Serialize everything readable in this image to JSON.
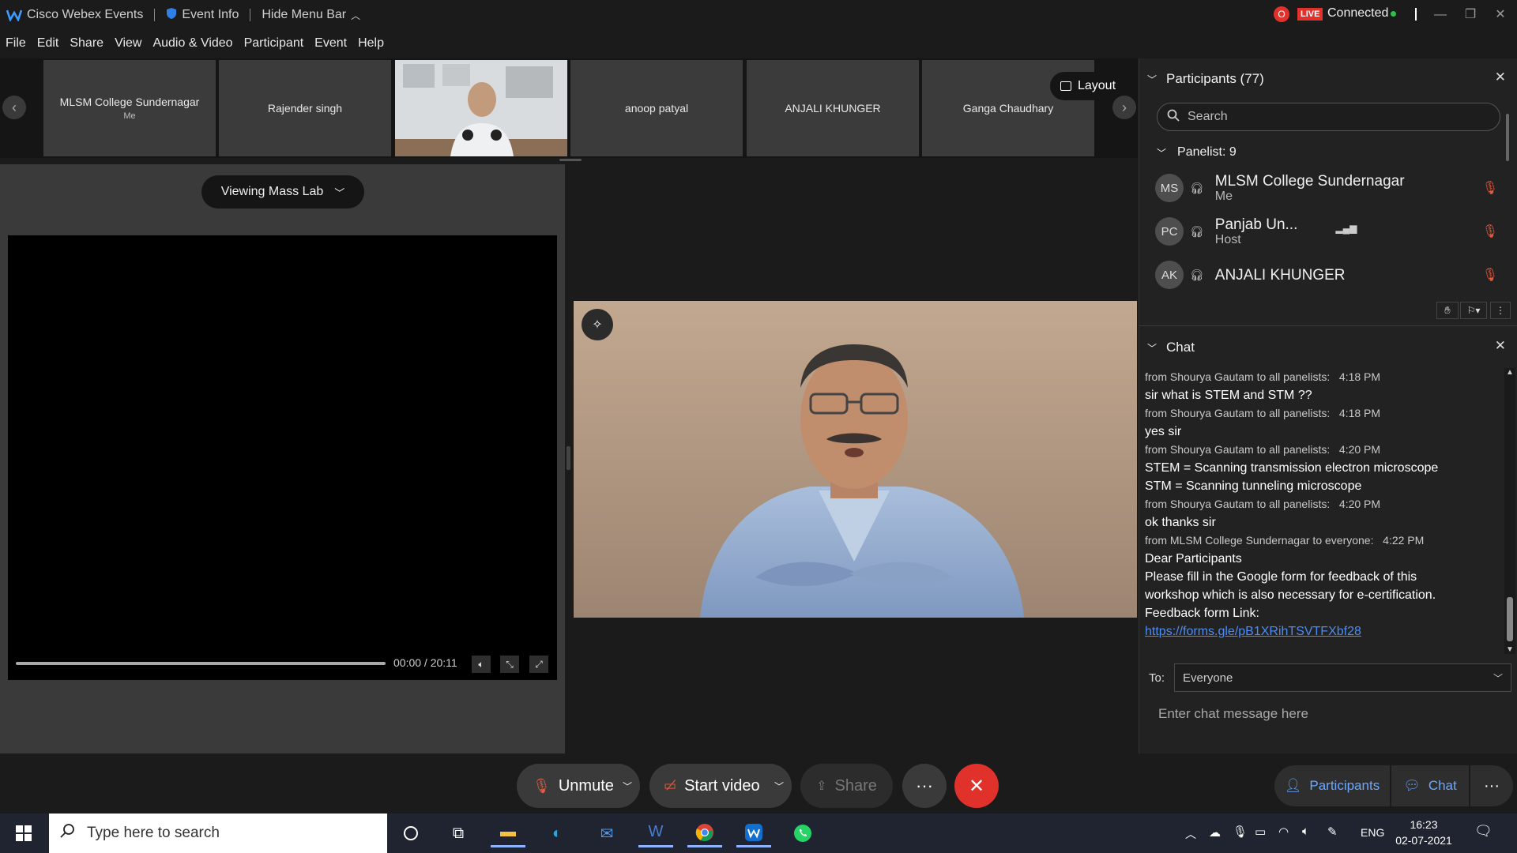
{
  "titlebar": {
    "app_name": "Cisco Webex Events",
    "event_info": "Event Info",
    "hide_menu": "Hide Menu Bar",
    "live_badge": "LIVE",
    "record_label": "O",
    "connected": "Connected"
  },
  "menu": [
    "File",
    "Edit",
    "Share",
    "View",
    "Audio & Video",
    "Participant",
    "Event",
    "Help"
  ],
  "strip": {
    "thumbs": [
      {
        "name": "MLSM College Sundernagar",
        "sub": "Me"
      },
      {
        "name": "Rajender singh",
        "sub": ""
      },
      {
        "name": "",
        "sub": ""
      },
      {
        "name": "anoop patyal",
        "sub": ""
      },
      {
        "name": "ANJALI KHUNGER",
        "sub": ""
      },
      {
        "name": "Ganga Chaudhary",
        "sub": ""
      }
    ],
    "layout_label": "Layout"
  },
  "player": {
    "viewing_label": "Viewing Mass Lab",
    "time": "00:00 / 20:11",
    "progress": 0
  },
  "participants": {
    "header": "Participants (77)",
    "search_placeholder": "Search",
    "panelist_group": "Panelist: 9",
    "list": [
      {
        "initials": "MS",
        "name": "MLSM College Sundernagar",
        "role": "Me"
      },
      {
        "initials": "PC",
        "name": "Panjab Un...",
        "role": "Host"
      },
      {
        "initials": "AK",
        "name": "ANJALI KHUNGER",
        "role": ""
      }
    ]
  },
  "chat": {
    "header": "Chat",
    "messages": [
      {
        "meta_from": "from Shourya Gautam to all panelists:",
        "time": "4:18 PM",
        "lines": [
          "sir what is STEM and STM ??"
        ]
      },
      {
        "meta_from": "from Shourya Gautam to all panelists:",
        "time": "4:18 PM",
        "lines": [
          "yes sir"
        ]
      },
      {
        "meta_from": "from Shourya Gautam to all panelists:",
        "time": "4:20 PM",
        "lines": [
          "STEM = Scanning transmission electron microscope",
          "STM = Scanning tunneling microscope"
        ]
      },
      {
        "meta_from": "from Shourya Gautam to all panelists:",
        "time": "4:20 PM",
        "lines": [
          "ok thanks sir"
        ]
      },
      {
        "meta_from": "from MLSM College Sundernagar to everyone:",
        "time": "4:22 PM",
        "lines": [
          "Dear Participants",
          "Please fill in the Google form for feedback of this",
          "workshop which is also necessary for e-certification.",
          "Feedback form Link:"
        ]
      }
    ],
    "link": "https://forms.gle/pB1XRihTSVTFXbf28",
    "to_label": "To:",
    "to_value": "Everyone",
    "input_placeholder": "Enter chat message here"
  },
  "toolbar": {
    "unmute": "Unmute",
    "start_video": "Start video",
    "share": "Share",
    "participants": "Participants",
    "chat": "Chat"
  },
  "taskbar": {
    "search_placeholder": "Type here to search",
    "lang": "ENG",
    "time": "16:23",
    "date": "02-07-2021"
  }
}
